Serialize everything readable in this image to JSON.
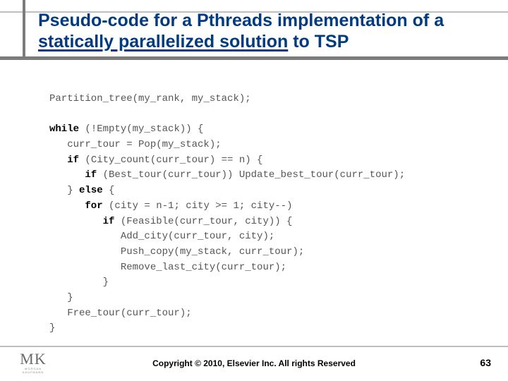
{
  "title": {
    "line1_plain": "Pseudo-code for a Pthreads implementation of a",
    "line2_prefix": "statically parallelized solution",
    "line2_suffix": " to TSP"
  },
  "code": {
    "l01a": "Partition_tree(my_rank, my_stack);",
    "l02": "",
    "l03a": "while",
    "l03b": " (!Empty(my_stack)) {",
    "l04": "   curr_tour = Pop(my_stack);",
    "l05a": "   if",
    "l05b": " (City_count(curr_tour) == n) {",
    "l06a": "      if",
    "l06b": " (Best_tour(curr_tour)) Update_best_tour(curr_tour);",
    "l07a": "   } ",
    "l07b": "else",
    "l07c": " {",
    "l08a": "      for",
    "l08b": " (city = n-1; city >= 1; city--)",
    "l09a": "         if",
    "l09b": " (Feasible(curr_tour, city)) {",
    "l10": "            Add_city(curr_tour, city);",
    "l11": "            Push_copy(my_stack, curr_tour);",
    "l12": "            Remove_last_city(curr_tour);",
    "l13": "         }",
    "l14": "   }",
    "l15": "   Free_tour(curr_tour);",
    "l16": "}"
  },
  "footer": {
    "copyright": "Copyright © 2010, Elsevier Inc. All rights Reserved",
    "page": "63",
    "logo_main": "MK",
    "logo_sub": "MORGAN KAUFMANN"
  }
}
